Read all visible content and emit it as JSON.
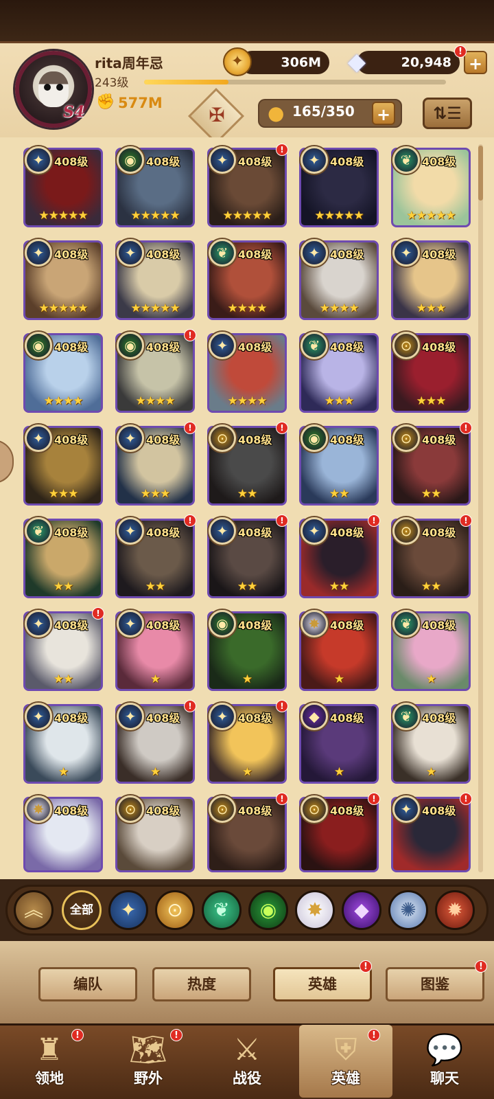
{
  "player": {
    "name": "rita周年忌",
    "level": "243级",
    "power": "577M",
    "season_badge": "S4",
    "exp_progress": 0.28
  },
  "resources": {
    "gold": "306M",
    "gems": "20,948"
  },
  "hero_capacity": "165/350",
  "heroes": [
    {
      "level": "408级",
      "stars": 5,
      "faction": "celestial",
      "dot": false,
      "portrait": [
        "#7a1a1a",
        "#3a2a3a"
      ]
    },
    {
      "level": "408级",
      "stars": 5,
      "faction": "wilder",
      "dot": false,
      "portrait": [
        "#5a6d85",
        "#2b3242"
      ]
    },
    {
      "level": "408级",
      "stars": 5,
      "faction": "celestial",
      "dot": true,
      "portrait": [
        "#6a4a36",
        "#2a1e18"
      ]
    },
    {
      "level": "408级",
      "stars": 5,
      "faction": "celestial",
      "dot": false,
      "portrait": [
        "#2c2a44",
        "#141426"
      ]
    },
    {
      "level": "408级",
      "stars": 5,
      "faction": "verdant",
      "dot": false,
      "portrait": [
        "#f2dba8",
        "#9bc49a"
      ]
    },
    {
      "level": "408级",
      "stars": 5,
      "faction": "lightbearer",
      "dot": false,
      "portrait": [
        "#c9a576",
        "#5b3f2a"
      ]
    },
    {
      "level": "408级",
      "stars": 5,
      "faction": "lightbearer",
      "dot": false,
      "portrait": [
        "#d9cba8",
        "#3b3a48"
      ]
    },
    {
      "level": "408级",
      "stars": 4,
      "faction": "verdant",
      "dot": false,
      "portrait": [
        "#b0503a",
        "#3a1c18"
      ]
    },
    {
      "level": "408级",
      "stars": 4,
      "faction": "celestial",
      "dot": false,
      "portrait": [
        "#d9d4ce",
        "#5a4a3c"
      ]
    },
    {
      "level": "408级",
      "stars": 3,
      "faction": "lightbearer",
      "dot": false,
      "portrait": [
        "#e6c58a",
        "#3a3448"
      ]
    },
    {
      "level": "408级",
      "stars": 4,
      "faction": "wilder",
      "dot": false,
      "portrait": [
        "#b9d1ea",
        "#4f6d98"
      ]
    },
    {
      "level": "408级",
      "stars": 4,
      "faction": "wilder",
      "dot": true,
      "portrait": [
        "#c6c3a8",
        "#3a3a3a"
      ]
    },
    {
      "level": "408级",
      "stars": 4,
      "faction": "lightbearer",
      "dot": false,
      "portrait": [
        "#c04a3a",
        "#6a7c8a"
      ]
    },
    {
      "level": "408级",
      "stars": 3,
      "faction": "verdant",
      "dot": false,
      "portrait": [
        "#b9b4e6",
        "#2e2a58"
      ]
    },
    {
      "level": "408级",
      "stars": 3,
      "faction": "graveborn",
      "dot": false,
      "portrait": [
        "#9a1f2e",
        "#3a1a20"
      ]
    },
    {
      "level": "408级",
      "stars": 3,
      "faction": "celestial",
      "dot": false,
      "portrait": [
        "#a7823c",
        "#2e2418"
      ]
    },
    {
      "level": "408级",
      "stars": 3,
      "faction": "lightbearer",
      "dot": true,
      "portrait": [
        "#d2c4a0",
        "#223148"
      ]
    },
    {
      "level": "408级",
      "stars": 2,
      "faction": "graveborn",
      "dot": true,
      "portrait": [
        "#4a4a4a",
        "#1e1a1a"
      ]
    },
    {
      "level": "408级",
      "stars": 2,
      "faction": "wilder",
      "dot": false,
      "portrait": [
        "#9ab5d8",
        "#2a3a5a"
      ]
    },
    {
      "level": "408级",
      "stars": 2,
      "faction": "graveborn",
      "dot": true,
      "portrait": [
        "#8a3a3a",
        "#2a1818"
      ]
    },
    {
      "level": "408级",
      "stars": 2,
      "faction": "verdant",
      "dot": false,
      "portrait": [
        "#caa86a",
        "#1f3a2a"
      ]
    },
    {
      "level": "408级",
      "stars": 2,
      "faction": "lightbearer",
      "dot": true,
      "portrait": [
        "#6b5a4a",
        "#1e1a1e"
      ]
    },
    {
      "level": "408级",
      "stars": 2,
      "faction": "celestial",
      "dot": true,
      "portrait": [
        "#5a4a44",
        "#1a1618"
      ]
    },
    {
      "level": "408级",
      "stars": 2,
      "faction": "celestial",
      "dot": true,
      "portrait": [
        "#2a1e2a",
        "#9a2a2a"
      ]
    },
    {
      "level": "408级",
      "stars": 2,
      "faction": "graveborn",
      "dot": true,
      "portrait": [
        "#6a4a3a",
        "#2a1e18"
      ]
    },
    {
      "level": "408级",
      "stars": 2,
      "faction": "celestial",
      "dot": true,
      "portrait": [
        "#e8e4dc",
        "#5a5a6a"
      ]
    },
    {
      "level": "408级",
      "stars": 1,
      "faction": "lightbearer",
      "dot": false,
      "portrait": [
        "#e88aa8",
        "#5a2a3a"
      ]
    },
    {
      "level": "408级",
      "stars": 1,
      "faction": "wilder",
      "dot": false,
      "portrait": [
        "#3a6a2a",
        "#1a2a18"
      ]
    },
    {
      "level": "408级",
      "stars": 1,
      "faction": "dimensional",
      "dot": false,
      "portrait": [
        "#c63a2a",
        "#4a1a18"
      ]
    },
    {
      "level": "408级",
      "stars": 1,
      "faction": "verdant",
      "dot": false,
      "portrait": [
        "#e8a8c8",
        "#6a8a6a"
      ]
    },
    {
      "level": "408级",
      "stars": 1,
      "faction": "lightbearer",
      "dot": false,
      "portrait": [
        "#dfe6ea",
        "#3a4a5a"
      ]
    },
    {
      "level": "408级",
      "stars": 1,
      "faction": "lightbearer",
      "dot": true,
      "portrait": [
        "#cfcac4",
        "#3a2e28"
      ]
    },
    {
      "level": "408级",
      "stars": 1,
      "faction": "lightbearer",
      "dot": true,
      "portrait": [
        "#f2c45a",
        "#3a2a28"
      ]
    },
    {
      "level": "408级",
      "stars": 1,
      "faction": "hypogean",
      "dot": false,
      "portrait": [
        "#5a3a7a",
        "#241838"
      ]
    },
    {
      "level": "408级",
      "stars": 1,
      "faction": "verdant",
      "dot": false,
      "portrait": [
        "#e8e0d4",
        "#3a3028"
      ]
    },
    {
      "level": "408级",
      "stars": 0,
      "faction": "dimensional",
      "dot": false,
      "portrait": [
        "#e4e8f2",
        "#7a6aa8"
      ]
    },
    {
      "level": "408级",
      "stars": 0,
      "faction": "graveborn",
      "dot": false,
      "portrait": [
        "#d8cfc4",
        "#5a4a3a"
      ]
    },
    {
      "level": "408级",
      "stars": 0,
      "faction": "graveborn",
      "dot": true,
      "portrait": [
        "#6a4a3a",
        "#2e1e18"
      ]
    },
    {
      "level": "408级",
      "stars": 0,
      "faction": "graveborn",
      "dot": true,
      "portrait": [
        "#8a1e1e",
        "#2a1212"
      ]
    },
    {
      "level": "408级",
      "stars": 0,
      "faction": "celestial",
      "dot": true,
      "portrait": [
        "#2a2838",
        "#a02a2a"
      ]
    }
  ],
  "faction_colors": {
    "celestial": "#2f5d9a",
    "lightbearer": "#2f5d9a",
    "wilder": "#2e7d2a",
    "verdant": "#2a9a6a",
    "graveborn": "#c08a1a",
    "dimensional": "#e8e4f0",
    "hypogean": "#6a2aa8"
  },
  "filters": {
    "all_label": "全部",
    "factions": [
      "lightbearer-faction-icon",
      "mauler-faction-icon",
      "wilder-faction-icon",
      "graveborn-faction-icon",
      "celestial-faction-icon",
      "hypogean-faction-icon",
      "dimensional-faction-icon",
      "forsaken-faction-icon"
    ]
  },
  "subtabs": [
    {
      "label": "编队",
      "dot": false
    },
    {
      "label": "热度",
      "dot": false
    },
    {
      "label": "英雄",
      "dot": true
    },
    {
      "label": "图鉴",
      "dot": true
    }
  ],
  "nav": [
    {
      "label": "领地",
      "dot": true
    },
    {
      "label": "野外",
      "dot": true
    },
    {
      "label": "战役",
      "dot": false
    },
    {
      "label": "英雄",
      "dot": true
    },
    {
      "label": "聊天",
      "dot": false
    }
  ]
}
